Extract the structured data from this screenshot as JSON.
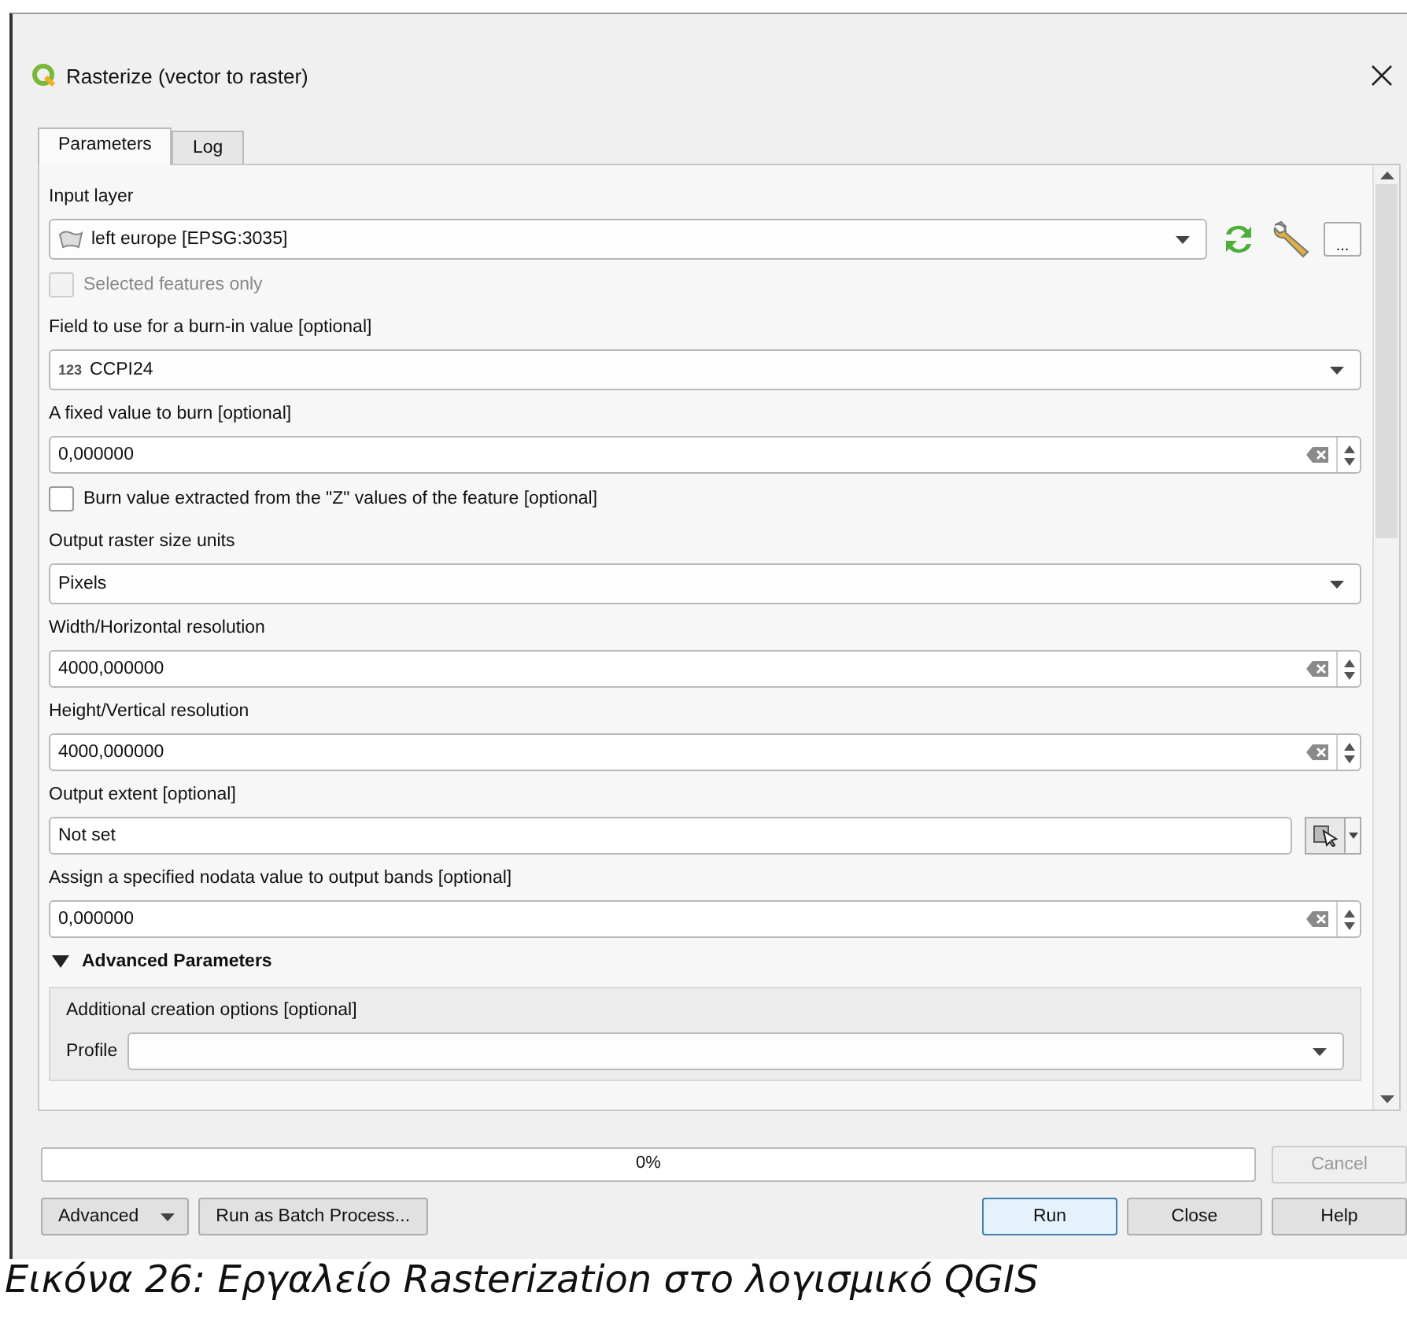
{
  "window": {
    "title": "Rasterize (vector to raster)"
  },
  "tabs": [
    {
      "label": "Parameters",
      "selected": true
    },
    {
      "label": "Log",
      "selected": false
    }
  ],
  "parameters": [
    {
      "kind": "layer",
      "label": "Input layer",
      "value": "left europe [EPSG:3035]",
      "more_button": "..."
    },
    {
      "kind": "checkbox",
      "label": "Selected features only",
      "checked": false,
      "disabled": true
    },
    {
      "kind": "combo",
      "label": "Field to use for a burn-in value [optional]",
      "prefix": "123",
      "value": "CCPI24"
    },
    {
      "kind": "number",
      "label": "A fixed value to burn [optional]",
      "value": "0,000000"
    },
    {
      "kind": "checkbox",
      "label": "Burn value extracted from the \"Z\" values of the feature [optional]",
      "checked": false,
      "disabled": false
    },
    {
      "kind": "combo",
      "label": "Output raster size units",
      "value": "Pixels"
    },
    {
      "kind": "number",
      "label": "Width/Horizontal resolution",
      "value": "4000,000000"
    },
    {
      "kind": "number",
      "label": "Height/Vertical resolution",
      "value": "4000,000000"
    },
    {
      "kind": "extent",
      "label": "Output extent [optional]",
      "value": "Not set"
    },
    {
      "kind": "number",
      "label": "Assign a specified nodata value to output bands [optional]",
      "value": "0,000000"
    }
  ],
  "advanced": {
    "title": "Advanced Parameters",
    "expanded": true,
    "group_label": "Additional creation options [optional]",
    "profile_label": "Profile"
  },
  "progress": {
    "level": 0,
    "text": "0%"
  },
  "cancel": {
    "label": "Cancel",
    "disabled": true
  },
  "left_buttons": [
    {
      "label": "Advanced",
      "kind": "menu"
    },
    {
      "label": "Run as Batch Process...",
      "kind": "plain"
    }
  ],
  "right_buttons": [
    {
      "label": "Run",
      "kind": "default"
    },
    {
      "label": "Close",
      "kind": "plain"
    },
    {
      "label": "Help",
      "kind": "plain"
    }
  ],
  "caption": "Εικόνα 26: Εργαλείο Rasterization στο λογισμικό QGIS"
}
